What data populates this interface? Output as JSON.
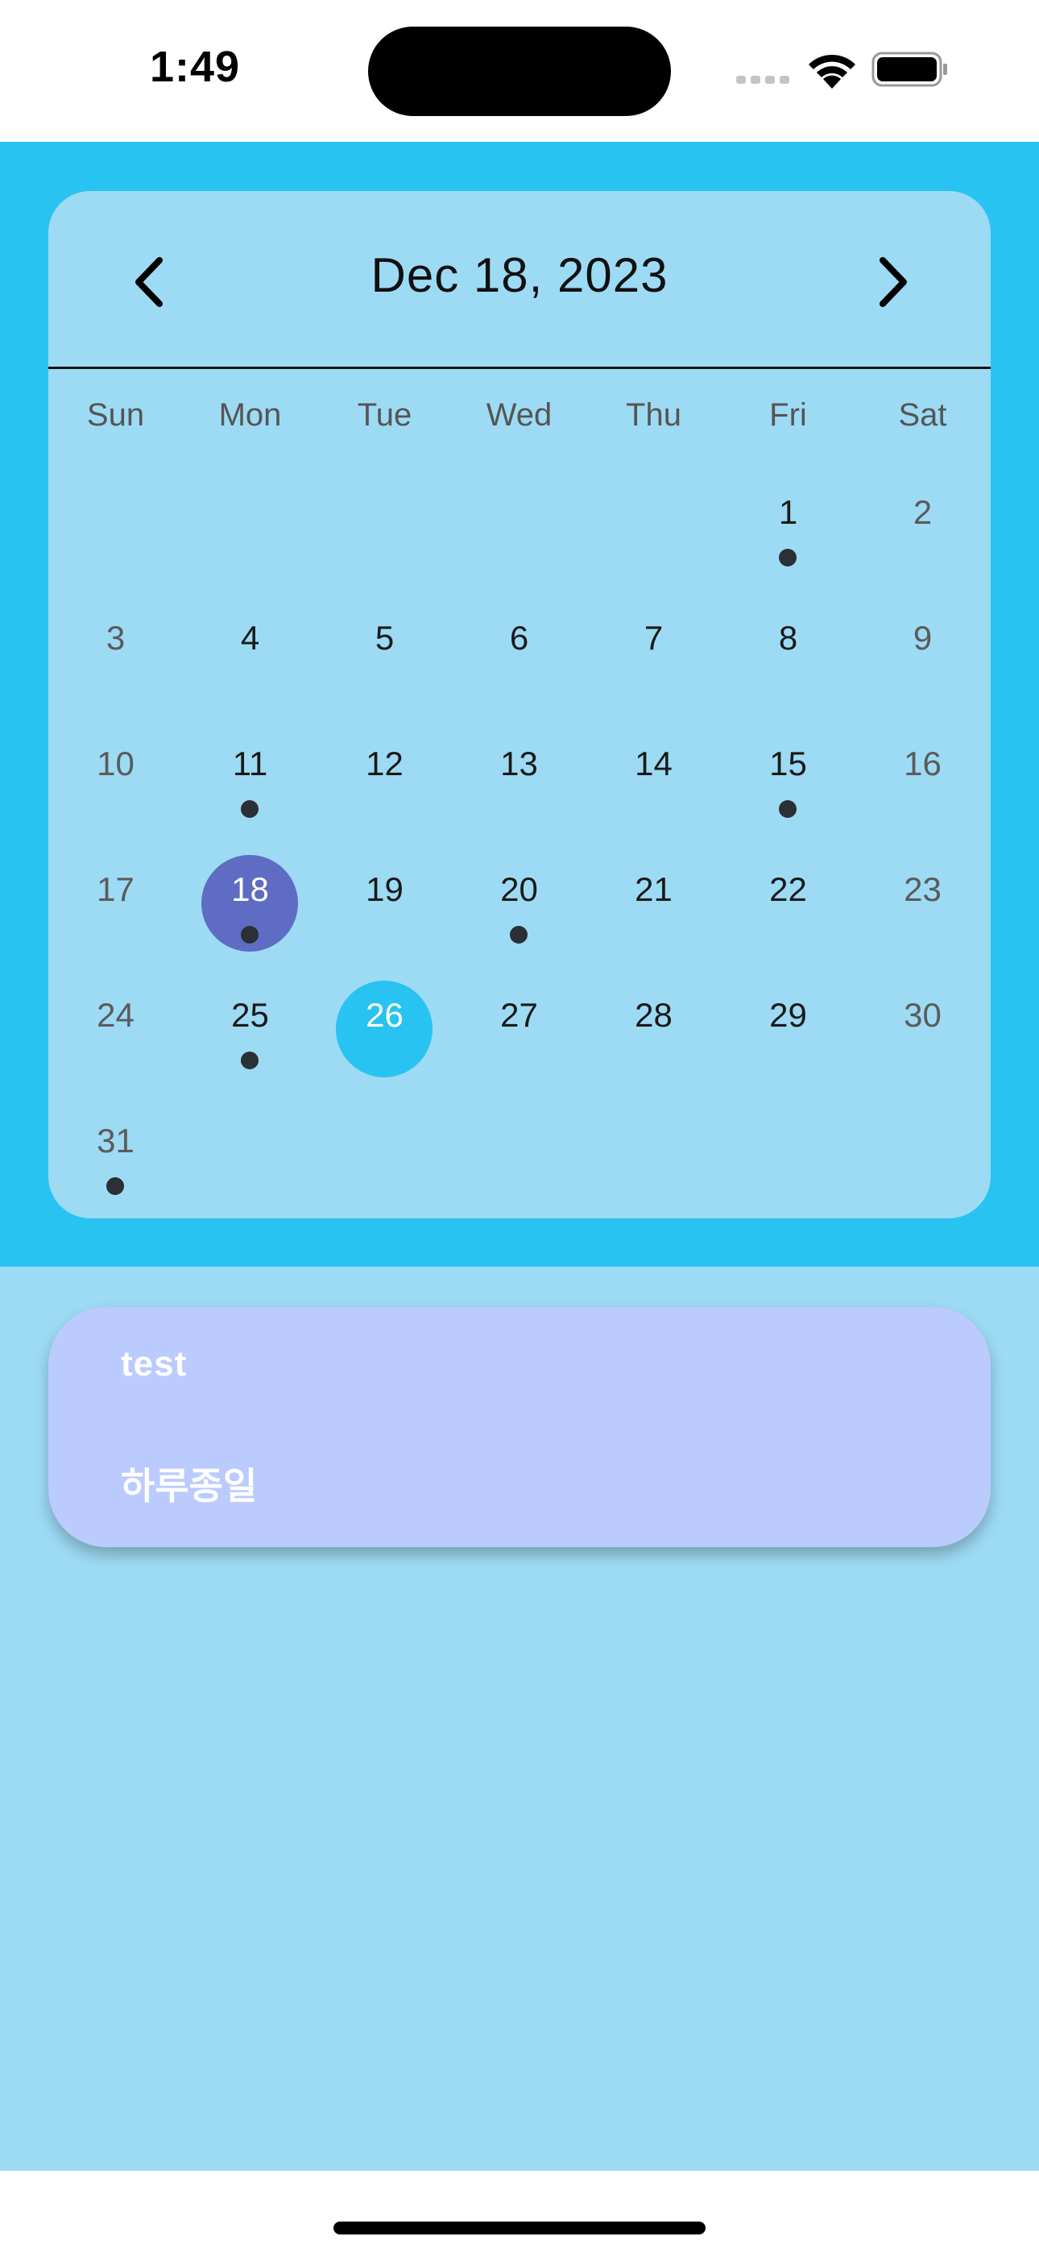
{
  "status_bar": {
    "time": "1:49"
  },
  "calendar": {
    "title": "Dec 18, 2023",
    "weekdays": [
      "Sun",
      "Mon",
      "Tue",
      "Wed",
      "Thu",
      "Fri",
      "Sat"
    ],
    "days": [
      {
        "label": "1",
        "col": 5,
        "row": 0,
        "event": true
      },
      {
        "label": "2",
        "col": 6,
        "row": 0,
        "event": false
      },
      {
        "label": "3",
        "col": 0,
        "row": 1,
        "event": false
      },
      {
        "label": "4",
        "col": 1,
        "row": 1,
        "event": false
      },
      {
        "label": "5",
        "col": 2,
        "row": 1,
        "event": false
      },
      {
        "label": "6",
        "col": 3,
        "row": 1,
        "event": false
      },
      {
        "label": "7",
        "col": 4,
        "row": 1,
        "event": false
      },
      {
        "label": "8",
        "col": 5,
        "row": 1,
        "event": false
      },
      {
        "label": "9",
        "col": 6,
        "row": 1,
        "event": false
      },
      {
        "label": "10",
        "col": 0,
        "row": 2,
        "event": false
      },
      {
        "label": "11",
        "col": 1,
        "row": 2,
        "event": true
      },
      {
        "label": "12",
        "col": 2,
        "row": 2,
        "event": false
      },
      {
        "label": "13",
        "col": 3,
        "row": 2,
        "event": false
      },
      {
        "label": "14",
        "col": 4,
        "row": 2,
        "event": false
      },
      {
        "label": "15",
        "col": 5,
        "row": 2,
        "event": true
      },
      {
        "label": "16",
        "col": 6,
        "row": 2,
        "event": false
      },
      {
        "label": "17",
        "col": 0,
        "row": 3,
        "event": false
      },
      {
        "label": "18",
        "col": 1,
        "row": 3,
        "event": true,
        "state": "selected"
      },
      {
        "label": "19",
        "col": 2,
        "row": 3,
        "event": false
      },
      {
        "label": "20",
        "col": 3,
        "row": 3,
        "event": true
      },
      {
        "label": "21",
        "col": 4,
        "row": 3,
        "event": false
      },
      {
        "label": "22",
        "col": 5,
        "row": 3,
        "event": false
      },
      {
        "label": "23",
        "col": 6,
        "row": 3,
        "event": false
      },
      {
        "label": "24",
        "col": 0,
        "row": 4,
        "event": false
      },
      {
        "label": "25",
        "col": 1,
        "row": 4,
        "event": true
      },
      {
        "label": "26",
        "col": 2,
        "row": 4,
        "event": false,
        "state": "today"
      },
      {
        "label": "27",
        "col": 3,
        "row": 4,
        "event": false
      },
      {
        "label": "28",
        "col": 4,
        "row": 4,
        "event": false
      },
      {
        "label": "29",
        "col": 5,
        "row": 4,
        "event": false
      },
      {
        "label": "30",
        "col": 6,
        "row": 4,
        "event": false
      },
      {
        "label": "31",
        "col": 0,
        "row": 5,
        "event": true
      }
    ],
    "icons": {
      "prev": "chevron-left-icon",
      "next": "chevron-right-icon"
    }
  },
  "events": [
    {
      "title": "test",
      "subtitle": "하루종일"
    }
  ],
  "colors": {
    "header_bg": "#29c3f2",
    "calendar_bg": "#9ddbf4",
    "selected": "#5f6cc4",
    "today": "#29c3f2",
    "event_card": "#bccbfd",
    "event_dot": "#2b2f36"
  }
}
